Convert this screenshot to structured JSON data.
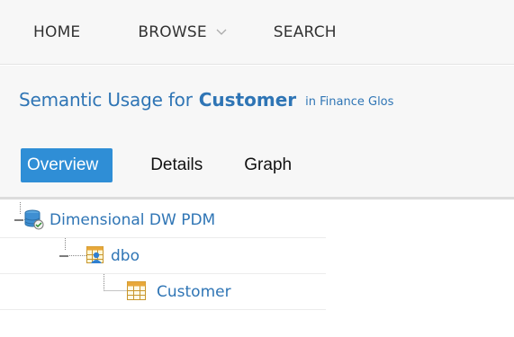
{
  "nav": {
    "home": "HOME",
    "browse": "BROWSE",
    "search": "SEARCH"
  },
  "title": {
    "prefix": "Semantic Usage for",
    "entity": "Customer",
    "context": "in Finance Glos"
  },
  "tabs": [
    {
      "label": "Overview",
      "active": true
    },
    {
      "label": "Details",
      "active": false
    },
    {
      "label": "Graph",
      "active": false
    }
  ],
  "tree": [
    {
      "label": "Dimensional DW PDM",
      "icon": "database-icon",
      "expanded": true
    },
    {
      "label": "dbo",
      "icon": "schema-owner-icon",
      "expanded": true
    },
    {
      "label": "Customer",
      "icon": "table-icon"
    }
  ],
  "colors": {
    "accent": "#2f8ed6",
    "link": "#2f75b5",
    "bar_background": "#f7f7f7"
  }
}
